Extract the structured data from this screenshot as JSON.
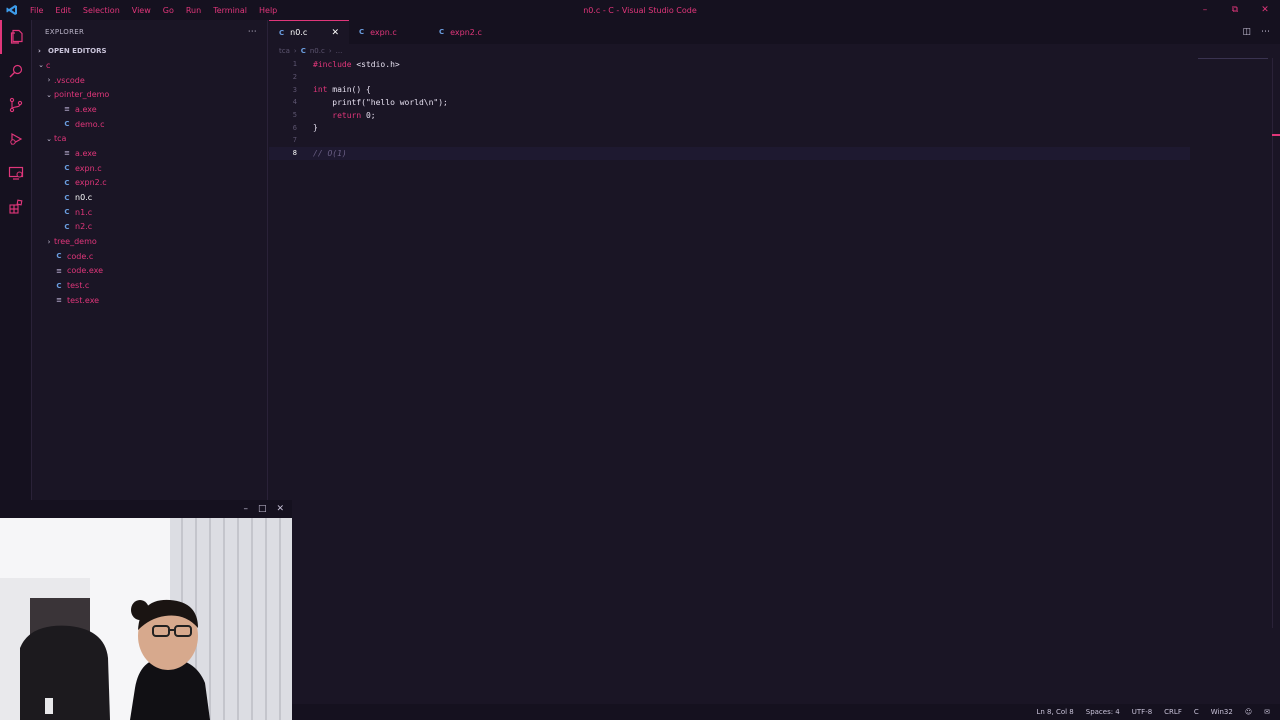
{
  "window": {
    "title": "n0.c - C - Visual Studio Code",
    "menu": [
      "File",
      "Edit",
      "Selection",
      "View",
      "Go",
      "Run",
      "Terminal",
      "Help"
    ]
  },
  "sidebar": {
    "header": "EXPLORER",
    "section": "OPEN EDITORS",
    "tree": [
      {
        "label": "c",
        "kind": "folder-open",
        "depth": 0
      },
      {
        "label": ".vscode",
        "kind": "folder-closed",
        "depth": 1
      },
      {
        "label": "pointer_demo",
        "kind": "folder-open",
        "depth": 1
      },
      {
        "label": "a.exe",
        "kind": "exe",
        "depth": 2
      },
      {
        "label": "demo.c",
        "kind": "c",
        "depth": 2
      },
      {
        "label": "tca",
        "kind": "folder-open",
        "depth": 1
      },
      {
        "label": "a.exe",
        "kind": "exe",
        "depth": 2
      },
      {
        "label": "expn.c",
        "kind": "c",
        "depth": 2
      },
      {
        "label": "expn2.c",
        "kind": "c",
        "depth": 2
      },
      {
        "label": "n0.c",
        "kind": "c",
        "depth": 2,
        "active": true
      },
      {
        "label": "n1.c",
        "kind": "c",
        "depth": 2
      },
      {
        "label": "n2.c",
        "kind": "c",
        "depth": 2
      },
      {
        "label": "tree_demo",
        "kind": "folder-closed",
        "depth": 1
      },
      {
        "label": "code.c",
        "kind": "c",
        "depth": 1
      },
      {
        "label": "code.exe",
        "kind": "exe",
        "depth": 1
      },
      {
        "label": "test.c",
        "kind": "c",
        "depth": 1
      },
      {
        "label": "test.exe",
        "kind": "exe",
        "depth": 1
      }
    ]
  },
  "tabs": [
    {
      "label": "n0.c",
      "active": true
    },
    {
      "label": "expn.c",
      "active": false
    },
    {
      "label": "expn2.c",
      "active": false
    }
  ],
  "breadcrumb": [
    "tca",
    "n0.c",
    "..."
  ],
  "editor": {
    "lines": [
      {
        "n": "1",
        "tokens": [
          [
            "kw",
            "#include"
          ],
          [
            "",
            " <stdio.h>"
          ]
        ]
      },
      {
        "n": "2",
        "tokens": []
      },
      {
        "n": "3",
        "tokens": [
          [
            "kw",
            "int"
          ],
          [
            "",
            " main() {"
          ]
        ]
      },
      {
        "n": "4",
        "tokens": [
          [
            "",
            "    printf("
          ],
          [
            "str",
            "\"hello world\\n\""
          ],
          [
            "",
            ");"
          ]
        ]
      },
      {
        "n": "5",
        "tokens": [
          [
            "",
            "    "
          ],
          [
            "kw",
            "return"
          ],
          [
            "",
            " 0;"
          ]
        ]
      },
      {
        "n": "6",
        "tokens": [
          [
            "",
            "}"
          ]
        ]
      },
      {
        "n": "7",
        "tokens": []
      },
      {
        "n": "8",
        "tokens": [
          [
            "cmt",
            "// O(1)"
          ]
        ],
        "current": true
      }
    ]
  },
  "statusbar": [
    "Ln 8, Col 8",
    "Spaces: 4",
    "UTF-8",
    "CRLF",
    "C",
    "Win32"
  ],
  "icons": {
    "activity": [
      "explorer-icon",
      "search-icon",
      "source-control-icon",
      "run-debug-icon",
      "remote-explorer-icon",
      "extensions-icon"
    ]
  },
  "colors": {
    "accent": "#e0367a",
    "background": "#1a1525",
    "c_icon": "#6b9ee0"
  }
}
